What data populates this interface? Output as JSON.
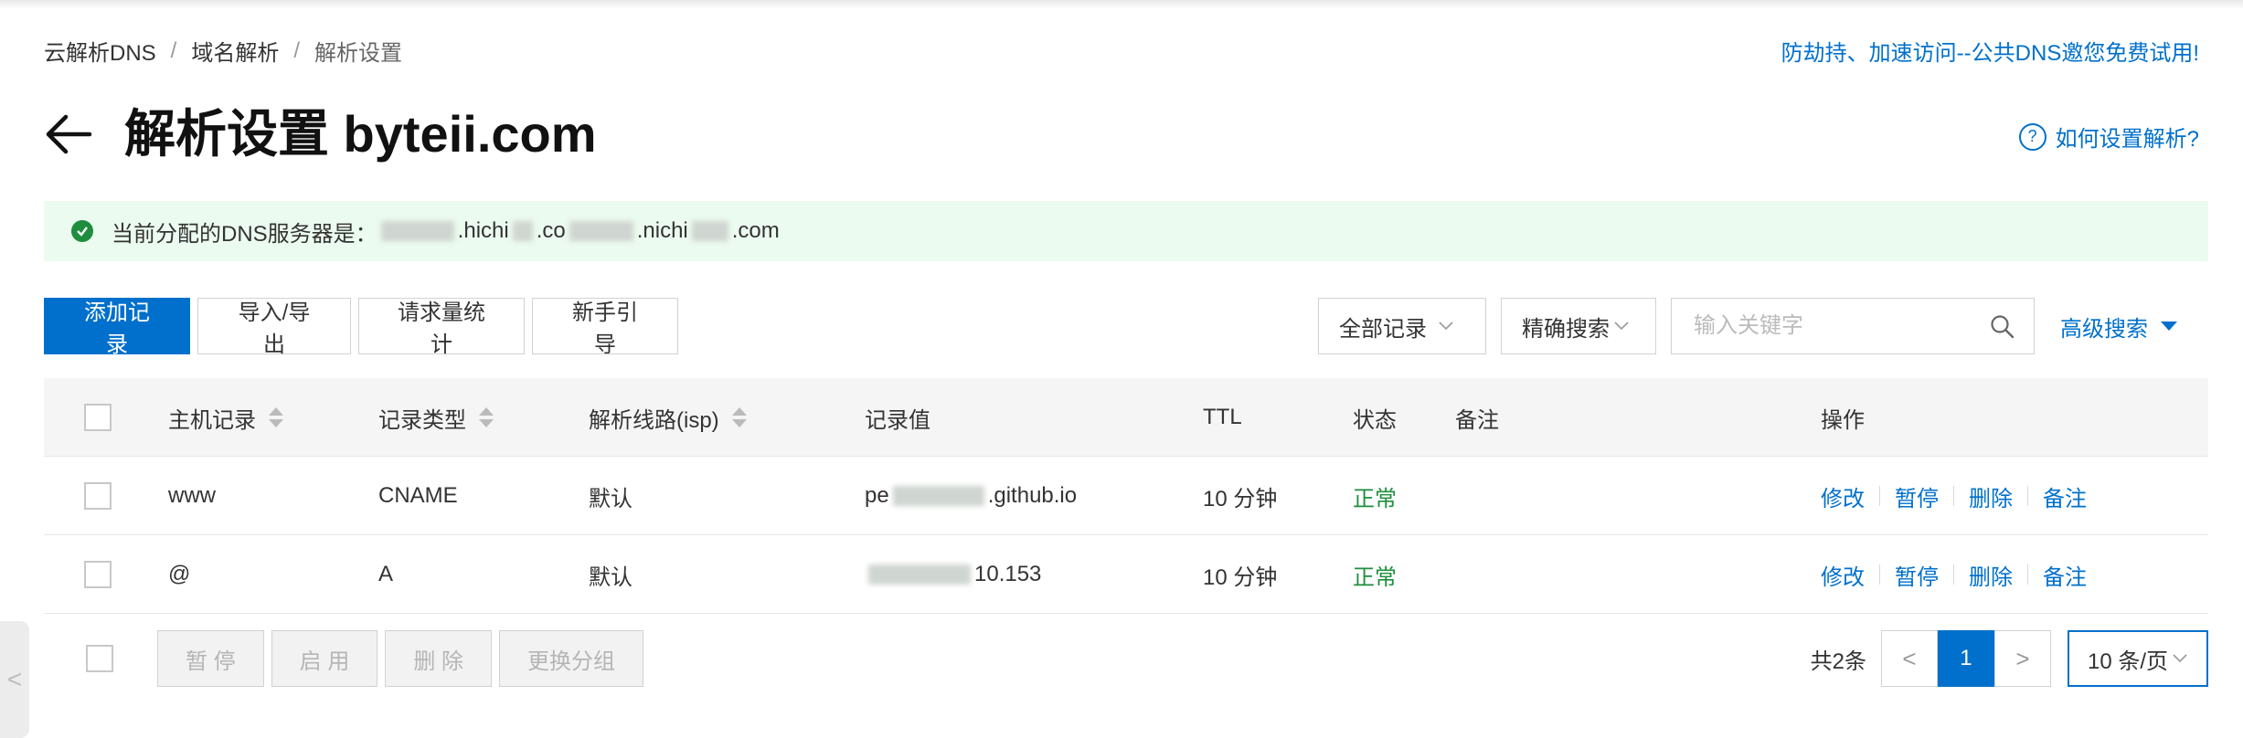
{
  "breadcrumb": {
    "items": [
      "云解析DNS",
      "域名解析",
      "解析设置"
    ],
    "separator": "/"
  },
  "promo_link": "防劫持、加速访问--公共DNS邀您免费试用!",
  "title": "解析设置 byteii.com",
  "help_link": "如何设置解析?",
  "help_icon_glyph": "?",
  "notice": {
    "prefix": "当前分配的DNS服务器是：",
    "visible_fragments": [
      ".hichi",
      ".co",
      ".nichi",
      ".com"
    ]
  },
  "toolbar": {
    "add": "添加记录",
    "import_export": "导入/导出",
    "stats": "请求量统计",
    "guide": "新手引导"
  },
  "filters": {
    "record_filter": "全部记录",
    "search_mode": "精确搜索",
    "search_placeholder": "输入关键字",
    "advanced": "高级搜索"
  },
  "table": {
    "headers": {
      "host": "主机记录",
      "type": "记录类型",
      "line": "解析线路(isp)",
      "value": "记录值",
      "ttl": "TTL",
      "status": "状态",
      "remark": "备注",
      "ops": "操作"
    },
    "rows": [
      {
        "host": "www",
        "type": "CNAME",
        "line": "默认",
        "value_prefix": "pe",
        "value_suffix": ".github.io",
        "ttl": "10 分钟",
        "status": "正常"
      },
      {
        "host": "@",
        "type": "A",
        "line": "默认",
        "value_prefix": "",
        "value_suffix": "10.153",
        "ttl": "10 分钟",
        "status": "正常"
      }
    ],
    "actions": [
      "修改",
      "暂停",
      "删除",
      "备注"
    ]
  },
  "bulk": {
    "pause": "暂 停",
    "enable": "启 用",
    "delete": "删 除",
    "change_group": "更换分组"
  },
  "pager": {
    "total": "共2条",
    "prev": "<",
    "current": "1",
    "next": ">",
    "page_size": "10 条/页"
  },
  "side_handle": "<",
  "colors": {
    "primary": "#0070cc",
    "success": "#1e8e3e",
    "notice_bg": "#ecfbef",
    "header_bg": "#f5f5f5"
  }
}
